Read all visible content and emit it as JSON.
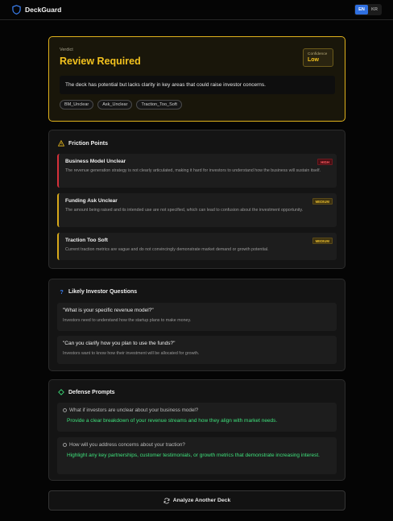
{
  "header": {
    "app_name": "DeckGuard",
    "languages": [
      "EN",
      "KR"
    ],
    "active_language": "EN"
  },
  "verdict": {
    "label": "Verdict",
    "title": "Review Required",
    "confidence_label": "Confidence",
    "confidence_value": "Low",
    "summary": "The deck has potential but lacks clarity in key areas that could raise investor concerns.",
    "tags": [
      "BM_Unclear",
      "Ask_Unclear",
      "Traction_Too_Soft"
    ]
  },
  "friction": {
    "title": "Friction Points",
    "items": [
      {
        "name": "Business Model Unclear",
        "severity": "HIGH",
        "description": "The revenue generation strategy is not clearly articulated, making it hard for investors to understand how the business will sustain itself."
      },
      {
        "name": "Funding Ask Unclear",
        "severity": "MEDIUM",
        "description": "The amount being raised and its intended use are not specified, which can lead to confusion about the investment opportunity."
      },
      {
        "name": "Traction Too Soft",
        "severity": "MEDIUM",
        "description": "Current traction metrics are vague and do not convincingly demonstrate market demand or growth potential."
      }
    ]
  },
  "questions": {
    "title": "Likely Investor Questions",
    "items": [
      {
        "question": "\"What is your specific revenue model?\"",
        "reason": "Investors need to understand how the startup plans to make money."
      },
      {
        "question": "\"Can you clarify how you plan to use the funds?\"",
        "reason": "Investors want to know how their investment will be allocated for growth."
      }
    ]
  },
  "defense": {
    "title": "Defense Prompts",
    "items": [
      {
        "question": "What if investors are unclear about your business model?",
        "answer": "Provide a clear breakdown of your revenue streams and how they align with market needs."
      },
      {
        "question": "How will you address concerns about your traction?",
        "answer": "Highlight any key partnerships, customer testimonials, or growth metrics that demonstrate increasing interest."
      }
    ]
  },
  "actions": {
    "analyze_label": "Analyze Another Deck"
  },
  "colors": {
    "accent_yellow": "#f3c21e",
    "high": "#d6303a",
    "medium": "#d8a91a",
    "answer_green": "#3ee07b",
    "lang_active": "#2f6fe0"
  }
}
